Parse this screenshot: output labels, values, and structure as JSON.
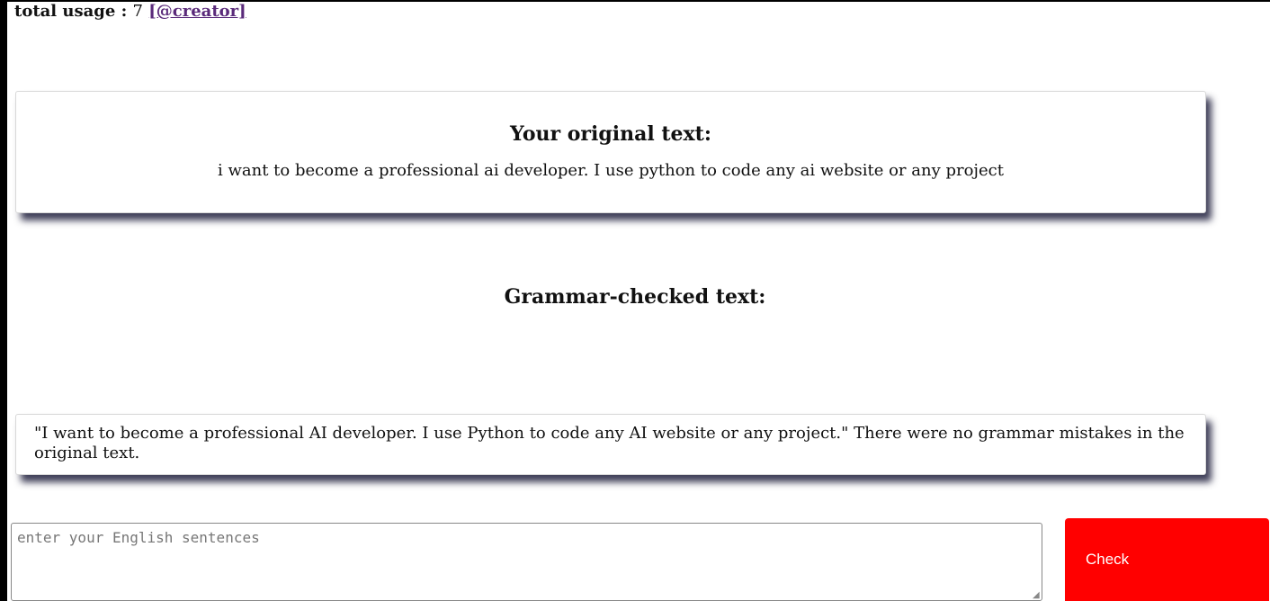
{
  "usage": {
    "label": "total usage : ",
    "count": "7",
    "creator_link": "[@creator]"
  },
  "original": {
    "heading": "Your original text:",
    "text": "i want to become a professional ai developer. I use python to code any ai website or any project"
  },
  "checked": {
    "heading": "Grammar-checked text:",
    "text": "\"I want to become a professional AI developer. I use Python to code any AI website or any project.\" There were no grammar mistakes in the original text."
  },
  "form": {
    "placeholder": "enter your English sentences",
    "value": "",
    "button_label": "Check",
    "button_color": "#ff0000"
  }
}
